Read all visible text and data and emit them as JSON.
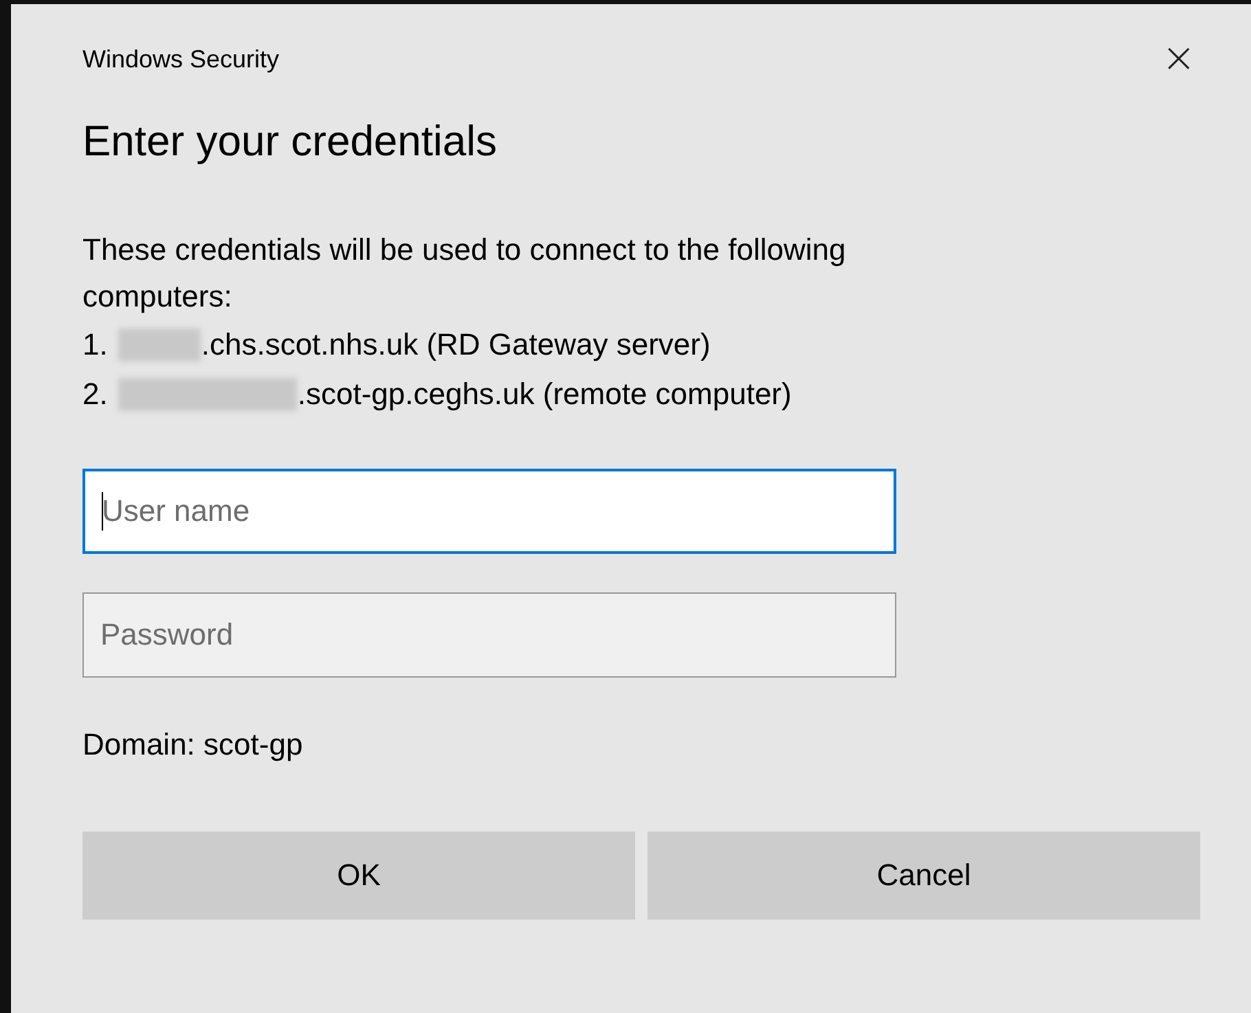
{
  "window": {
    "title": "Windows Security",
    "close": "×"
  },
  "heading": "Enter your credentials",
  "message": "These credentials will be used to connect to the following computers:",
  "computers": [
    {
      "number": "1.",
      "name_hidden": true,
      "host": ".chs.scot.nhs.uk (RD Gateway server)"
    },
    {
      "number": "2.",
      "name_hidden": true,
      "host": ".scot-gp.ceghs.uk (remote computer)"
    }
  ],
  "fields": [
    {
      "placeholder": "User name",
      "focused": true
    },
    {
      "placeholder": "Password",
      "focused": false
    }
  ],
  "domain": "Domain: scot-gp",
  "buttons": [
    "OK",
    "Cancel"
  ]
}
